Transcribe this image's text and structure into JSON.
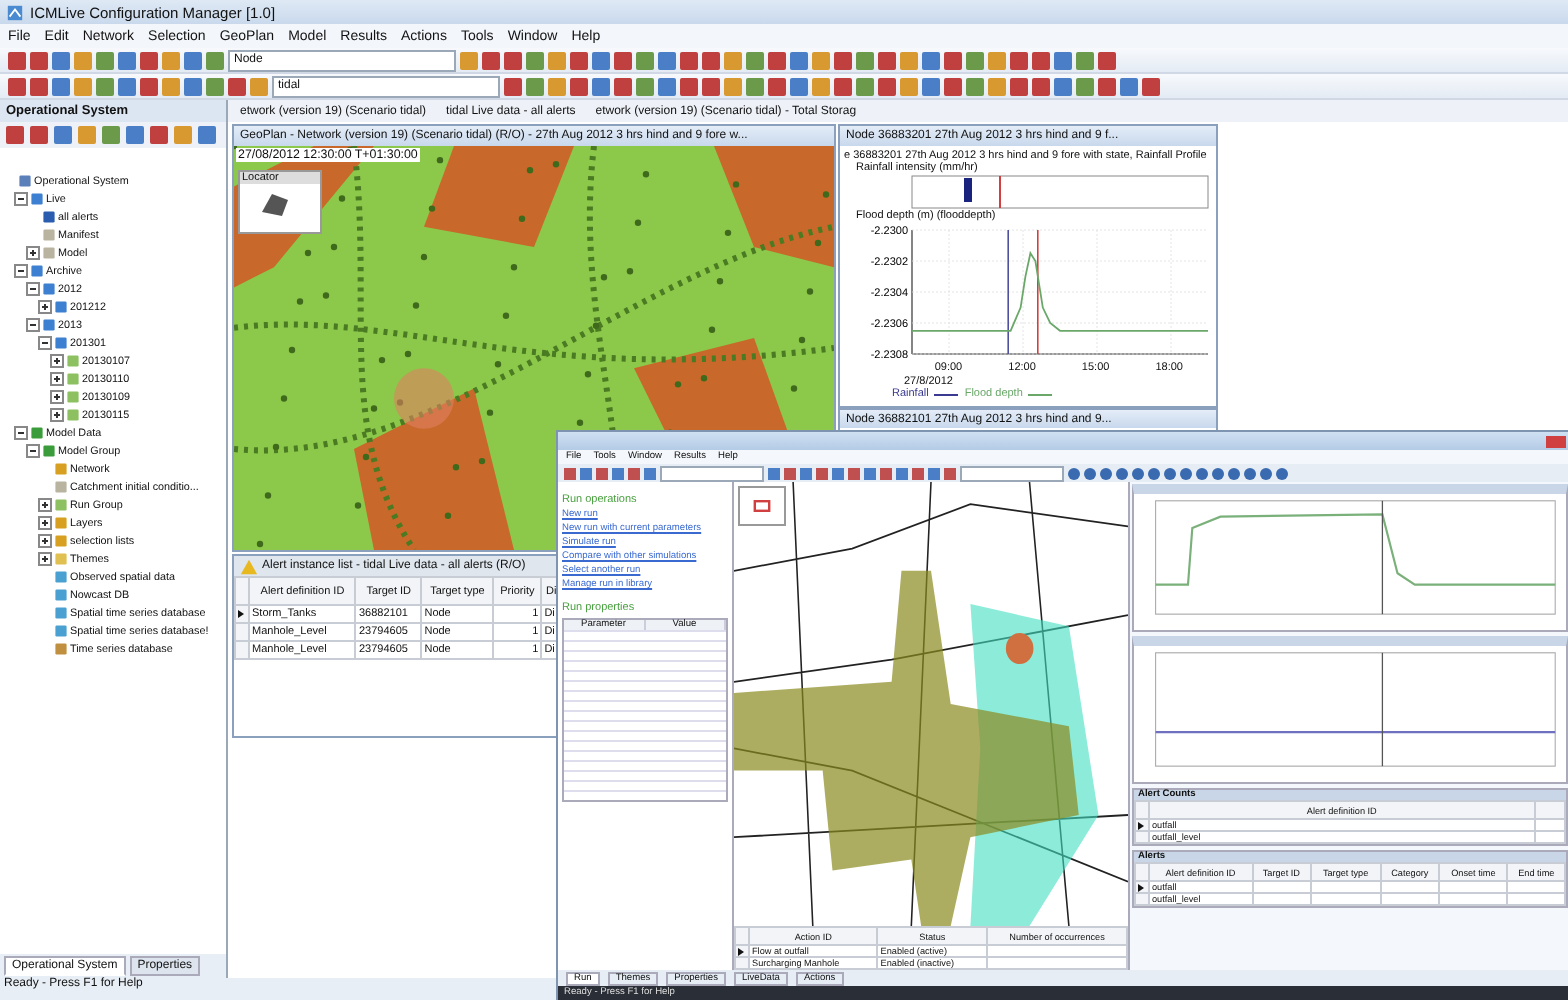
{
  "main_window": {
    "title": "ICMLive Configuration Manager [1.0]",
    "menu": [
      "File",
      "Edit",
      "Network",
      "Selection",
      "GeoPlan",
      "Model",
      "Results",
      "Actions",
      "Tools",
      "Window",
      "Help"
    ],
    "toolbar_combos": [
      "Node",
      "tidal"
    ],
    "side_panel": {
      "title": "Operational System",
      "tree": [
        {
          "label": "Operational System",
          "kind": "system",
          "children": [
            {
              "label": "Live",
              "kind": "folder",
              "expanded": true,
              "children": [
                {
                  "label": "all alerts",
                  "kind": "alert"
                },
                {
                  "label": "Manifest",
                  "kind": "doc"
                },
                {
                  "label": "Model",
                  "kind": "doc",
                  "expanded": false
                }
              ]
            },
            {
              "label": "Archive",
              "kind": "folder",
              "expanded": true,
              "children": [
                {
                  "label": "2012",
                  "kind": "folder",
                  "expanded": true,
                  "children": [
                    {
                      "label": "201212",
                      "kind": "folder",
                      "expanded": false
                    }
                  ]
                },
                {
                  "label": "2013",
                  "kind": "folder",
                  "expanded": true,
                  "children": [
                    {
                      "label": "201301",
                      "kind": "folder",
                      "expanded": true,
                      "children": [
                        {
                          "label": "20130107",
                          "kind": "run",
                          "expanded": false
                        },
                        {
                          "label": "20130110",
                          "kind": "run",
                          "expanded": false
                        },
                        {
                          "label": "20130109",
                          "kind": "run",
                          "expanded": false
                        },
                        {
                          "label": "20130115",
                          "kind": "run",
                          "expanded": false
                        }
                      ]
                    }
                  ]
                }
              ]
            },
            {
              "label": "Model Data",
              "kind": "model",
              "expanded": true,
              "children": [
                {
                  "label": "Model Group",
                  "kind": "model",
                  "expanded": true,
                  "children": [
                    {
                      "label": "Network",
                      "kind": "network"
                    },
                    {
                      "label": "Catchment initial conditio...",
                      "kind": "doc"
                    },
                    {
                      "label": "Run Group",
                      "kind": "run",
                      "expanded": false
                    },
                    {
                      "label": "Layers",
                      "kind": "network",
                      "expanded": false
                    },
                    {
                      "label": "selection lists",
                      "kind": "network",
                      "expanded": false
                    },
                    {
                      "label": "Themes",
                      "kind": "theme",
                      "expanded": false
                    },
                    {
                      "label": "Observed spatial data",
                      "kind": "spatial"
                    },
                    {
                      "label": "Nowcast DB",
                      "kind": "spatial"
                    },
                    {
                      "label": "Spatial time series database",
                      "kind": "spatial"
                    },
                    {
                      "label": "Spatial time series database!",
                      "kind": "spatial"
                    },
                    {
                      "label": "Time series database",
                      "kind": "table"
                    }
                  ]
                }
              ]
            }
          ]
        }
      ],
      "tabs": [
        {
          "label": "Operational System",
          "selected": true
        },
        {
          "label": "Properties",
          "selected": false
        }
      ]
    },
    "document_tabs": [
      {
        "label": "etwork (version 19) (Scenario tidal)",
        "selected": false
      },
      {
        "label": "tidal Live data - all alerts",
        "selected": false
      },
      {
        "label": "etwork (version 19) (Scenario tidal) - Total Storag",
        "selected": false
      }
    ],
    "geoplan": {
      "title": "GeoPlan - Network (version 19) (Scenario tidal) (R/O) - 27th Aug 2012 3 hrs hind and 9 fore w...",
      "timestamp": "27/08/2012 12:30:00 T+01:30:00",
      "locator": "Locator"
    },
    "node_window": {
      "title": "Node 36883201 27th Aug 2012 3 hrs hind and 9 f...",
      "chart_heading": "e 36883201 27th Aug 2012 3 hrs hind and 9 fore with state, Rainfall Profile",
      "rainfall_label": "Rainfall intensity (mm/hr)",
      "rainfall_legend": "Rainfall",
      "date_label": "27/8/2012",
      "chart_data": {
        "type": "line",
        "ylabel": "Flood depth (m) (flooddepth)",
        "x": [
          7.5,
          9,
          10.5,
          11.5,
          11.9,
          12.1,
          12.3,
          12.5,
          12.8,
          13.1,
          13.5,
          15,
          18,
          19.5
        ],
        "series": [
          {
            "name": "Flood depth",
            "color": "#6aa86a",
            "values": [
              -2.23065,
              -2.23065,
              -2.23065,
              -2.23065,
              -2.2305,
              -2.2303,
              -2.23015,
              -2.2302,
              -2.2305,
              -2.2306,
              -2.23065,
              -2.23065,
              -2.23065,
              -2.23065
            ]
          }
        ],
        "xlim": [
          7.5,
          19.5
        ],
        "ylim": [
          -2.2308,
          -2.23
        ],
        "xticks": [
          {
            "value": 9,
            "label": "09:00"
          },
          {
            "value": 12,
            "label": "12:00"
          },
          {
            "value": 15,
            "label": "15:00"
          },
          {
            "value": 18,
            "label": "18:00"
          }
        ],
        "yticks": [
          {
            "value": -2.23,
            "label": "-2.2300"
          },
          {
            "value": -2.2302,
            "label": "-2.2302"
          },
          {
            "value": -2.2304,
            "label": "-2.2304"
          },
          {
            "value": -2.2306,
            "label": "-2.2306"
          },
          {
            "value": -2.2308,
            "label": "-2.2308"
          }
        ],
        "grid": true,
        "ref_lines": [
          {
            "axis": "x",
            "value": 11.4,
            "color": "#5050a0"
          },
          {
            "axis": "x",
            "value": 12.6,
            "color": "#d04040"
          }
        ]
      }
    },
    "node_window_2": {
      "title": "Node 36882101 27th Aug 2012 3 hrs hind and 9..."
    },
    "alert_list": {
      "title": "Alert instance list - tidal Live data - all alerts (R/O)",
      "columns": [
        "Alert definition ID",
        "Target ID",
        "Target type",
        "Priority",
        "Di"
      ],
      "rows": [
        {
          "selected": true,
          "cells": [
            "Storm_Tanks",
            "36882101",
            "Node",
            "1",
            "Di"
          ]
        },
        {
          "selected": false,
          "cells": [
            "Manhole_Level",
            "23794605",
            "Node",
            "1",
            "Di"
          ]
        },
        {
          "selected": false,
          "cells": [
            "Manhole_Level",
            "23794605",
            "Node",
            "1",
            "Di"
          ]
        }
      ]
    },
    "status_bar": "Ready - Press F1 for Help"
  },
  "operator_window": {
    "menu": [
      "File",
      "Tools",
      "Window",
      "Results",
      "Help"
    ],
    "run_panel": {
      "heading": "Run operations",
      "links": [
        "New run",
        "New run with current parameters",
        "Simulate run",
        "Compare with other simulations",
        "Select another run",
        "Manage run in library"
      ],
      "properties_heading": "Run properties",
      "grid_columns": [
        "Parameter",
        "Value"
      ]
    },
    "actions_table": {
      "columns": [
        "Action ID",
        "Status",
        "Number of occurrences"
      ],
      "rows": [
        {
          "selected": true,
          "cells": [
            "Flow at outfall",
            "Enabled (active)"
          ]
        },
        {
          "selected": false,
          "cells": [
            "Surcharging Manhole",
            "Enabled (inactive)"
          ]
        }
      ]
    },
    "tabs": [
      {
        "label": "Run",
        "selected": true
      },
      {
        "label": "Themes",
        "selected": false
      },
      {
        "label": "Properties",
        "selected": false
      },
      {
        "label": "LiveData",
        "selected": false
      },
      {
        "label": "Actions",
        "selected": false
      }
    ],
    "alert_counts": {
      "title": "Alert Counts",
      "columns": [
        "Alert definition ID"
      ],
      "rows": [
        {
          "selected": true,
          "cells": [
            "outfall"
          ]
        },
        {
          "selected": false,
          "cells": [
            "outfall_level"
          ]
        }
      ]
    },
    "alerts": {
      "title": "Alerts",
      "columns": [
        "Alert definition ID",
        "Target ID",
        "Target type",
        "Category",
        "Onset time",
        "End time"
      ],
      "rows": [
        {
          "selected": true,
          "cells": [
            "outfall"
          ]
        },
        {
          "selected": false,
          "cells": [
            "outfall_level"
          ]
        }
      ]
    },
    "status_bar": "Ready - Press F1 for Help"
  }
}
